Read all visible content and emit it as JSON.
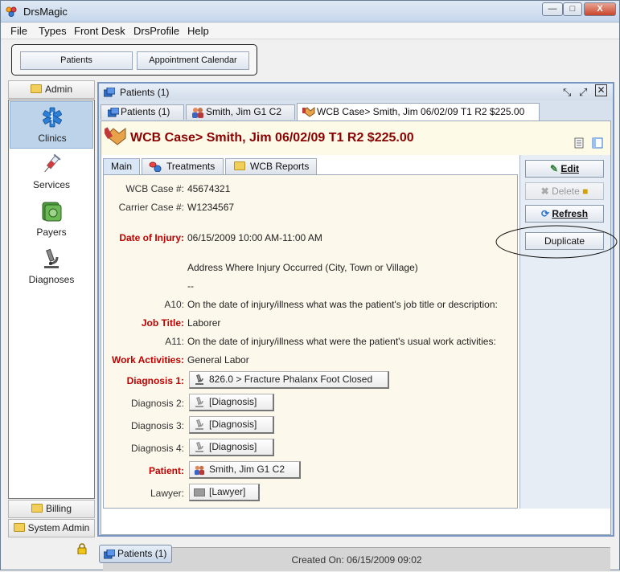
{
  "window": {
    "title": "DrsMagic",
    "minimize": "—",
    "maximize": "□",
    "close": "X"
  },
  "menu": [
    {
      "key": "F",
      "rest": "ile"
    },
    {
      "key": "T",
      "rest": "ypes",
      "prefix": ""
    },
    {
      "key": "F",
      "rest": "ront Desk"
    },
    {
      "key": "D",
      "rest": "rsProfile"
    },
    {
      "key": "H",
      "rest": "elp"
    }
  ],
  "menu_labels": [
    "File",
    "Types",
    "Front Desk",
    "DrsProfile",
    "Help"
  ],
  "toolbar": {
    "patients": "Patients",
    "appointment_calendar": "Appointment Calendar"
  },
  "left_panel": {
    "admin": "Admin",
    "items": [
      "Clinics",
      "Services",
      "Payers",
      "Diagnoses"
    ],
    "billing": "Billing",
    "system_admin": "System Admin"
  },
  "frame": {
    "title": "Patients (1)"
  },
  "tabs": [
    "Patients (1)",
    "Smith, Jim G1 C2",
    "WCB Case> Smith, Jim 06/02/09 T1 R2 $225.00"
  ],
  "case_header": "WCB Case> Smith, Jim 06/02/09 T1 R2 $225.00",
  "subtabs": [
    "Main",
    "Treatments",
    "WCB Reports"
  ],
  "form": {
    "wcb_case_label": "WCB Case #:",
    "wcb_case_value": "45674321",
    "carrier_case_label": "Carrier Case #:",
    "carrier_case_value": "W1234567",
    "date_of_injury_label": "Date of Injury:",
    "date_of_injury_value": "06/15/2009 10:00 AM-11:00 AM",
    "address_note": "Address Where Injury Occurred (City, Town or Village)",
    "address_value": "--",
    "a10_label": "A10:",
    "a10_text": "On the date of injury/illness what was the patient's job title or description:",
    "job_title_label": "Job Title:",
    "job_title_value": "Laborer",
    "a11_label": "A11:",
    "a11_text": "On the date of injury/illness what were the patient's usual work activities:",
    "work_activities_label": "Work Activities:",
    "work_activities_value": "General Labor",
    "diagnosis1_label": "Diagnosis 1:",
    "diagnosis1_value": "826.0 > Fracture Phalanx Foot Closed",
    "diagnosis2_label": "Diagnosis 2:",
    "diagnosis2_value": "[Diagnosis]",
    "diagnosis3_label": "Diagnosis 3:",
    "diagnosis3_value": "[Diagnosis]",
    "diagnosis4_label": "Diagnosis 4:",
    "diagnosis4_value": "[Diagnosis]",
    "patient_label": "Patient:",
    "patient_value": "Smith, Jim G1 C2",
    "lawyer_label": "Lawyer:",
    "lawyer_value": "[Lawyer]"
  },
  "actions": {
    "edit": "Edit",
    "delete": "Delete",
    "refresh": "Refresh",
    "duplicate": "Duplicate"
  },
  "created_on": "Created On:  06/15/2009 09:02",
  "taskbar": {
    "patients": "Patients (1)"
  },
  "colors": {
    "accent_red": "#8b0000",
    "label_red": "#c00000",
    "selection": "#bdd3ea",
    "frame_border": "#7995c2"
  }
}
